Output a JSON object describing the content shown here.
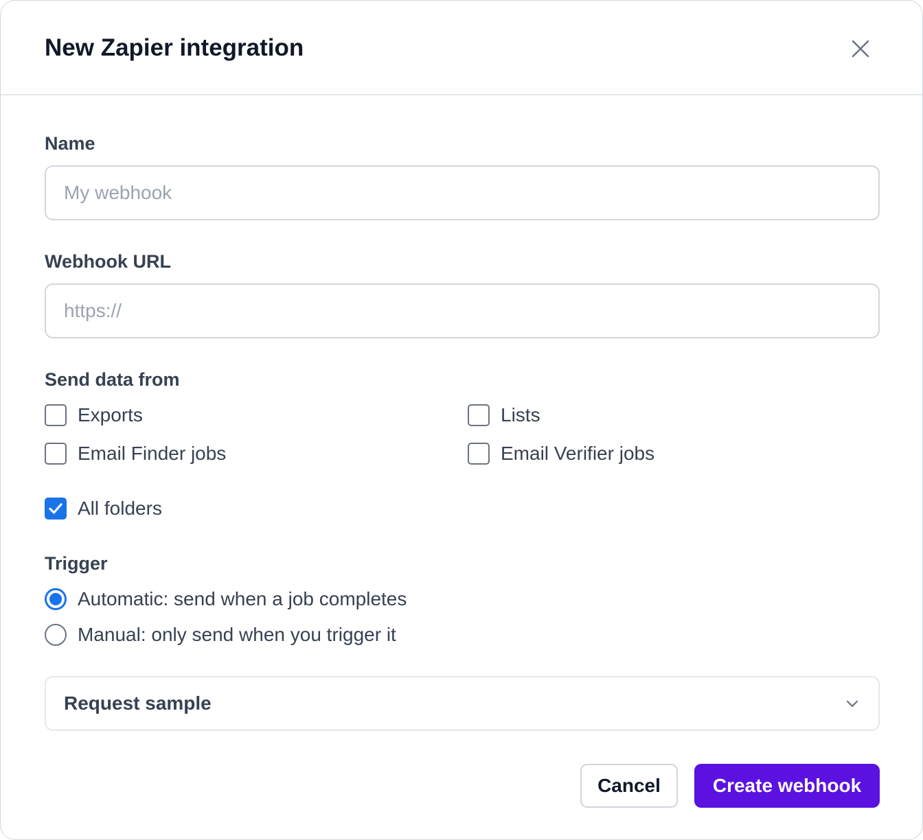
{
  "dialog": {
    "title": "New Zapier integration",
    "close_icon": "close-icon"
  },
  "fields": {
    "name": {
      "label": "Name",
      "placeholder": "My webhook",
      "value": ""
    },
    "webhook_url": {
      "label": "Webhook URL",
      "placeholder": "https://",
      "value": ""
    }
  },
  "send_data_from": {
    "label": "Send data from",
    "options": [
      {
        "label": "Exports",
        "checked": false
      },
      {
        "label": "Lists",
        "checked": false
      },
      {
        "label": "Email Finder jobs",
        "checked": false
      },
      {
        "label": "Email Verifier jobs",
        "checked": false
      }
    ],
    "all_folders": {
      "label": "All folders",
      "checked": true
    }
  },
  "trigger": {
    "label": "Trigger",
    "options": [
      {
        "label": "Automatic: send when a job completes",
        "selected": true
      },
      {
        "label": "Manual: only send when you trigger it",
        "selected": false
      }
    ]
  },
  "request_sample": {
    "label": "Request sample",
    "icon": "chevron-down-icon",
    "expanded": false
  },
  "actions": {
    "cancel_label": "Cancel",
    "create_label": "Create webhook"
  },
  "colors": {
    "accent": "#1a73e8",
    "primary_button": "#5b12e0"
  }
}
